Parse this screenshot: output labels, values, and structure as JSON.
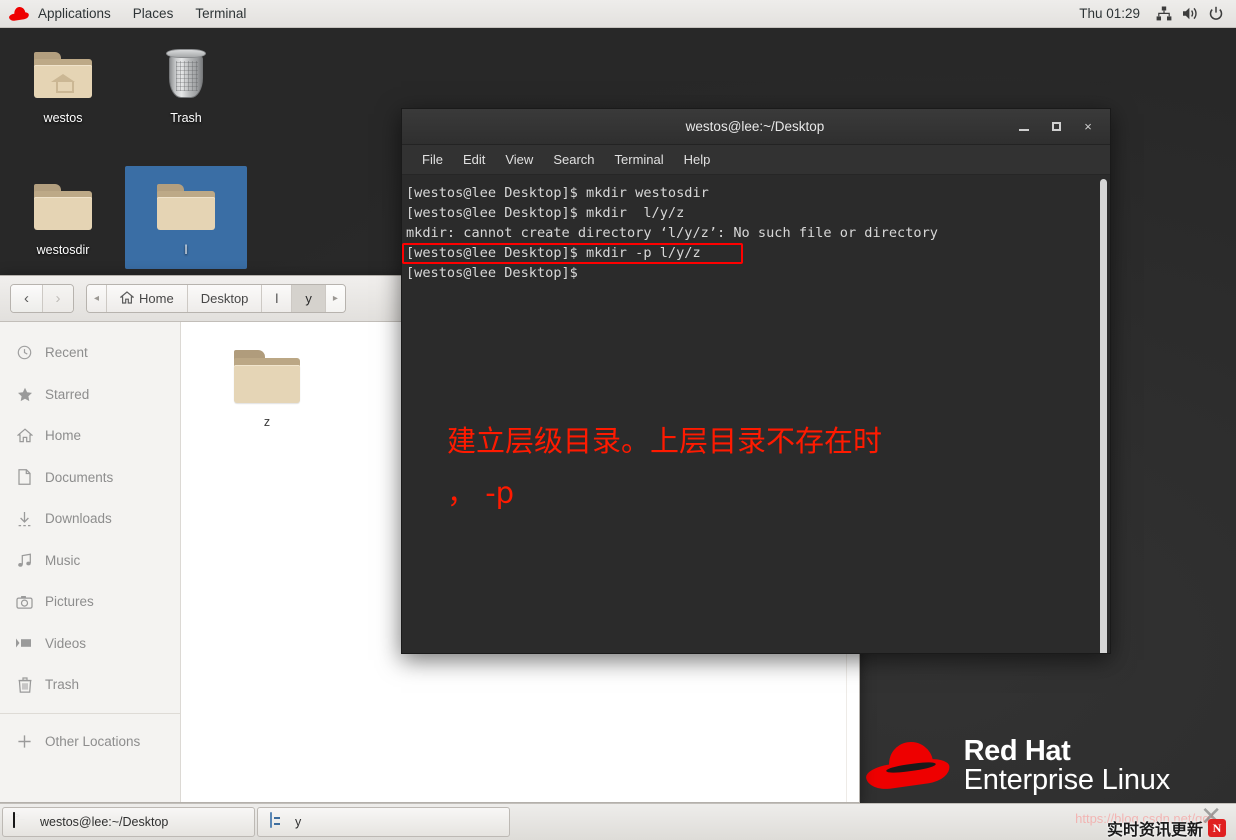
{
  "top_panel": {
    "logo_icon": "redhat-hat-icon",
    "menus": [
      "Applications",
      "Places",
      "Terminal"
    ],
    "clock": "Thu 01:29",
    "tray": [
      "network-icon",
      "volume-icon",
      "power-icon"
    ]
  },
  "desktop": {
    "icons": [
      {
        "label": "westos",
        "icon": "home-folder-icon",
        "selected": false
      },
      {
        "label": "Trash",
        "icon": "trash-icon",
        "selected": false
      },
      {
        "label": "westosdir",
        "icon": "folder-icon",
        "selected": false
      },
      {
        "label": "l",
        "icon": "folder-icon",
        "selected": true
      }
    ],
    "brand": {
      "line1": "Red Hat",
      "line2": "Enterprise Linux",
      "logo_icon": "redhat-hat-icon"
    }
  },
  "file_manager": {
    "nav": {
      "back": "‹",
      "forward": "›"
    },
    "breadcrumb": {
      "left_arrow": "◂",
      "right_arrow": "▸",
      "items": [
        {
          "label": "Home",
          "icon": "home-icon",
          "active": false
        },
        {
          "label": "Desktop",
          "icon": "",
          "active": false
        },
        {
          "label": "l",
          "icon": "",
          "active": false
        },
        {
          "label": "y",
          "icon": "",
          "active": true
        }
      ]
    },
    "sidebar": [
      {
        "label": "Recent",
        "icon": "clock-icon"
      },
      {
        "label": "Starred",
        "icon": "star-icon"
      },
      {
        "label": "Home",
        "icon": "home-icon"
      },
      {
        "label": "Documents",
        "icon": "document-icon"
      },
      {
        "label": "Downloads",
        "icon": "download-icon"
      },
      {
        "label": "Music",
        "icon": "music-icon"
      },
      {
        "label": "Pictures",
        "icon": "camera-icon"
      },
      {
        "label": "Videos",
        "icon": "video-icon"
      },
      {
        "label": "Trash",
        "icon": "trash-icon"
      }
    ],
    "sidebar_footer": {
      "label": "Other Locations",
      "icon": "plus-icon"
    },
    "files": [
      {
        "name": "z",
        "icon": "folder-icon"
      }
    ]
  },
  "terminal": {
    "title": "westos@lee:~/Desktop",
    "window_controls": {
      "minimize": "minimize-icon",
      "maximize": "maximize-icon",
      "close": "×"
    },
    "menus": [
      "File",
      "Edit",
      "View",
      "Search",
      "Terminal",
      "Help"
    ],
    "lines": [
      "[westos@lee Desktop]$ mkdir westosdir",
      "[westos@lee Desktop]$ mkdir  l/y/z",
      "mkdir: cannot create directory ‘l/y/z’: No such file or directory",
      "[westos@lee Desktop]$ mkdir -p l/y/z",
      "[westos@lee Desktop]$"
    ],
    "highlight": {
      "line_index": 3,
      "color": "#ff0000"
    },
    "annotation": {
      "line1": "建立层级目录。上层目录不存在时",
      "line2": "， -p",
      "color": "#ff1a00"
    }
  },
  "taskbar": {
    "items": [
      {
        "label": "westos@lee:~/Desktop",
        "icon": "terminal-icon"
      },
      {
        "label": "y",
        "icon": "files-icon"
      }
    ]
  },
  "watermark": {
    "url": "https://blog.csdn.net/qq/...",
    "close_glyph": "✕",
    "badge_text": "实时资讯更新",
    "badge_logo": "N"
  }
}
